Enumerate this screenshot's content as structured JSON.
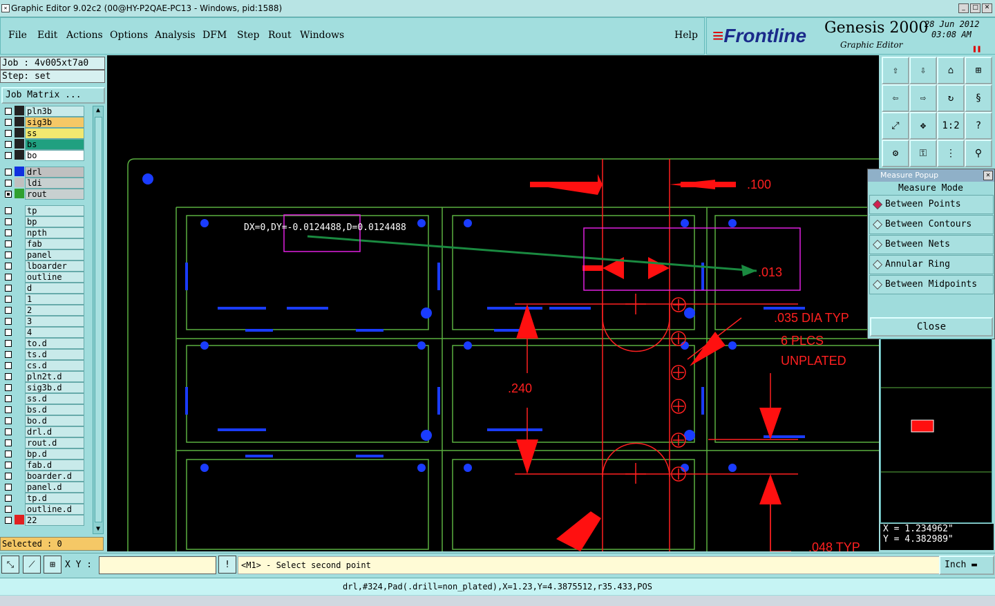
{
  "window": {
    "title": "Graphic Editor 9.02c2 (00@HY-P2QAE-PC13 - Windows, pid:1588)"
  },
  "menu": {
    "items": [
      "File",
      "Edit",
      "Actions",
      "Options",
      "Analysis",
      "DFM",
      "Step",
      "Rout",
      "Windows"
    ],
    "help": "Help"
  },
  "brand": {
    "logo": "Frontline",
    "product": "Genesis 2000",
    "subtitle": "Graphic Editor",
    "date": "28 Jun 2012",
    "time": "03:08 AM"
  },
  "job": {
    "job_line": "Job : 4v005xt7a0",
    "step_line": "Step: set",
    "matrix_button": "Job Matrix ..."
  },
  "layers": [
    {
      "name": "pln3b",
      "color": "#222222",
      "bg": "#c8eaea",
      "checked": false
    },
    {
      "name": "sig3b",
      "color": "#222222",
      "bg": "#f5c866",
      "checked": false
    },
    {
      "name": "ss",
      "color": "#222222",
      "bg": "#f2e870",
      "checked": false
    },
    {
      "name": "bs",
      "color": "#222222",
      "bg": "#20a080",
      "checked": false
    },
    {
      "name": "bo",
      "color": "#222222",
      "bg": "#ffffff",
      "checked": false
    },
    {
      "name": "drl",
      "color": "#1030e0",
      "bg": "#c0c0c0",
      "checked": false
    },
    {
      "name": "ldi",
      "color": "#c0c0c0",
      "bg": "#c8d0d0",
      "checked": false
    },
    {
      "name": "rout",
      "color": "#30a030",
      "bg": "#c8d0d0",
      "checked": true
    },
    {
      "name": "tp",
      "color": "",
      "bg": "#c8eaea",
      "checked": false
    },
    {
      "name": "bp",
      "color": "",
      "bg": "#c8eaea",
      "checked": false
    },
    {
      "name": "npth",
      "color": "",
      "bg": "#c8eaea",
      "checked": false
    },
    {
      "name": "fab",
      "color": "",
      "bg": "#c8eaea",
      "checked": false
    },
    {
      "name": "panel",
      "color": "",
      "bg": "#c8eaea",
      "checked": false
    },
    {
      "name": "lboarder",
      "color": "",
      "bg": "#c8eaea",
      "checked": false
    },
    {
      "name": "outline",
      "color": "",
      "bg": "#c8eaea",
      "checked": false
    },
    {
      "name": "d",
      "color": "",
      "bg": "#c8eaea",
      "checked": false
    },
    {
      "name": "1",
      "color": "",
      "bg": "#c8eaea",
      "checked": false
    },
    {
      "name": "2",
      "color": "",
      "bg": "#c8eaea",
      "checked": false
    },
    {
      "name": "3",
      "color": "",
      "bg": "#c8eaea",
      "checked": false
    },
    {
      "name": "4",
      "color": "",
      "bg": "#c8eaea",
      "checked": false
    },
    {
      "name": "to.d",
      "color": "",
      "bg": "#c8eaea",
      "checked": false
    },
    {
      "name": "ts.d",
      "color": "",
      "bg": "#c8eaea",
      "checked": false
    },
    {
      "name": "cs.d",
      "color": "",
      "bg": "#c8eaea",
      "checked": false
    },
    {
      "name": "pln2t.d",
      "color": "",
      "bg": "#c8eaea",
      "checked": false
    },
    {
      "name": "sig3b.d",
      "color": "",
      "bg": "#c8eaea",
      "checked": false
    },
    {
      "name": "ss.d",
      "color": "",
      "bg": "#c8eaea",
      "checked": false
    },
    {
      "name": "bs.d",
      "color": "",
      "bg": "#c8eaea",
      "checked": false
    },
    {
      "name": "bo.d",
      "color": "",
      "bg": "#c8eaea",
      "checked": false
    },
    {
      "name": "drl.d",
      "color": "",
      "bg": "#c8eaea",
      "checked": false
    },
    {
      "name": "rout.d",
      "color": "",
      "bg": "#c8eaea",
      "checked": false
    },
    {
      "name": "bp.d",
      "color": "",
      "bg": "#c8eaea",
      "checked": false
    },
    {
      "name": "fab.d",
      "color": "",
      "bg": "#c8eaea",
      "checked": false
    },
    {
      "name": "boarder.d",
      "color": "",
      "bg": "#c8eaea",
      "checked": false
    },
    {
      "name": "panel.d",
      "color": "",
      "bg": "#c8eaea",
      "checked": false
    },
    {
      "name": "tp.d",
      "color": "",
      "bg": "#c8eaea",
      "checked": false
    },
    {
      "name": "outline.d",
      "color": "",
      "bg": "#c8eaea",
      "checked": false
    },
    {
      "name": "22",
      "color": "#e02020",
      "bg": "#c8eaea",
      "checked": false
    }
  ],
  "selected_text": "Selected : 0",
  "canvas": {
    "measure_readout": "DX=0,DY=-0.0124488,D=0.0124488",
    "annotations": {
      "dim_100": ".100",
      "dim_013": ".013",
      "dim_240": ".240",
      "note_dia": ".035 DIA TYP",
      "note_plcs": "6 PLCS",
      "note_unplated": "UNPLATED",
      "dim_048": ".048 TYP"
    }
  },
  "measure_popup": {
    "title": "Measure Popup",
    "mode_label": "Measure Mode",
    "options": [
      "Between Points",
      "Between Contours",
      "Between Nets",
      "Annular Ring",
      "Between Midpoints"
    ],
    "selected_option": "Between Points",
    "close_label": "Close"
  },
  "coords": {
    "x": "X = 1.234962\"",
    "y": "Y = 4.382989\""
  },
  "bottom": {
    "xy_label": "X Y :",
    "xy_value": "",
    "prompt": "<M1> - Select second point",
    "unit": "Inch"
  },
  "status": "drl,#324,Pad(.drill=non_plated),X=1.23,Y=4.3875512,r35.433,POS"
}
